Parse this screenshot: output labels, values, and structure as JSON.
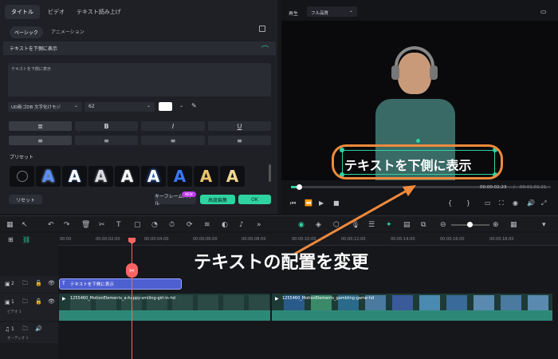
{
  "left_panel": {
    "tabs": [
      "タイトル",
      "ビデオ",
      "テキスト読み上げ"
    ],
    "subtabs": [
      "ベーシック",
      "アニメーション"
    ],
    "section_title": "テキストを下側に表示",
    "text_value": "テキストを下側に表示",
    "font_name": "UD新ゴDB 文字化けモジ",
    "font_size": "62",
    "format_buttons": [
      "B",
      "I",
      "U"
    ],
    "preset_label": "プリセット",
    "preset_glyph": "A",
    "reset_label": "リセット",
    "keyframe_label": "キーフレームパネル",
    "new_badge": "NEW",
    "advanced_label": "高度編集",
    "ok_label": "OK"
  },
  "preview": {
    "tab": "再生",
    "quality": "フル品質",
    "overlay_text": "テキストを下側に表示",
    "current_time": "00:00:02:23",
    "separator": "/",
    "total_time": "00:01:01:21"
  },
  "annotation": {
    "text": "テキストの配置を変更",
    "color": "#f08a3c"
  },
  "timeline": {
    "ruler": [
      "00:00",
      "00:00:02:00",
      "00:00:04:00",
      "00:00:06:00",
      "00:00:08:00",
      "00:00:10:00",
      "00:00:12:00",
      "00:00:14:00",
      "00:00:16:00",
      "00:00:18:00"
    ],
    "title_clip": "テキストを下側に表示",
    "video_clip_1": "1255460_MotionElements_a-happy-smiling-girl-in-hd",
    "video_clip_2": "1255460_MotionElements_gambling-game-hd",
    "track_labels": [
      "ビデオ 1",
      "オーディオ 1"
    ],
    "track_numbers": [
      "2",
      "1",
      "1"
    ]
  },
  "colors": {
    "accent_green": "#2ed3a0",
    "clip_blue": "#4e5fd2",
    "playhead": "#ff6464",
    "preset_blue": "#5a8cff",
    "preset_gold": "#e8c36a"
  }
}
